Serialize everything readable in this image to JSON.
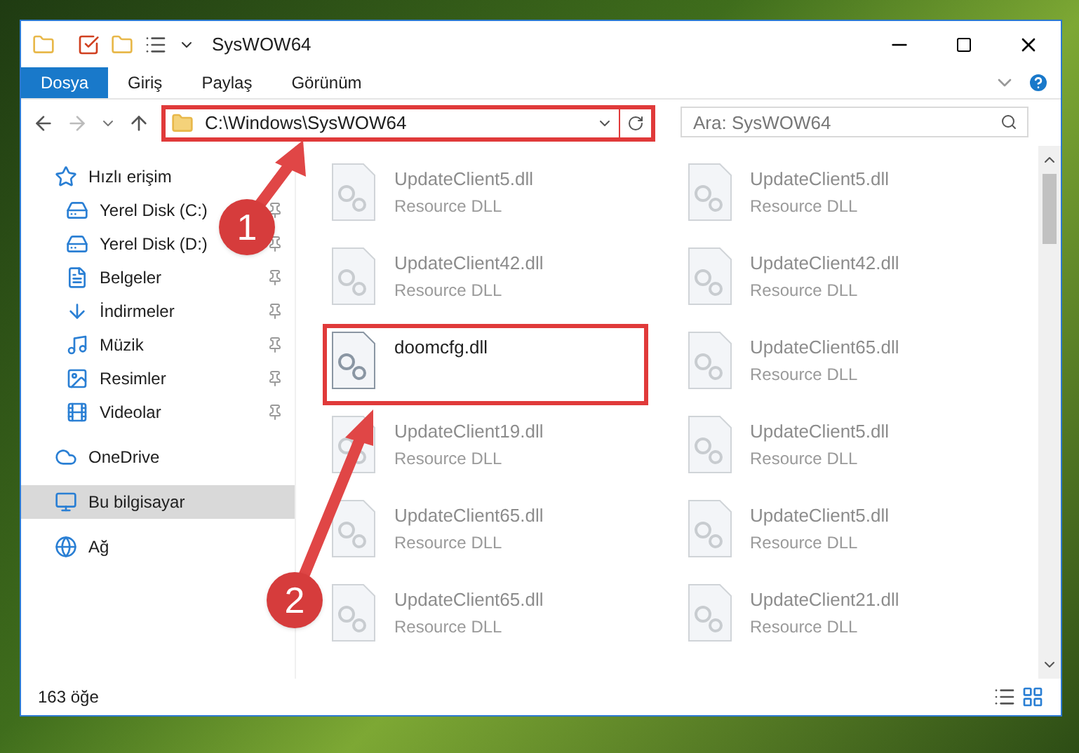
{
  "window": {
    "title": "SysWOW64"
  },
  "ribbon_tabs": [
    {
      "label": "Dosya",
      "selected": true
    },
    {
      "label": "Giriş",
      "selected": false
    },
    {
      "label": "Paylaş",
      "selected": false
    },
    {
      "label": "Görünüm",
      "selected": false
    }
  ],
  "address_bar": {
    "path": "C:\\Windows\\SysWOW64",
    "highlighted": true
  },
  "search": {
    "placeholder": "Ara: SysWOW64"
  },
  "sidebar": {
    "items": [
      {
        "label": "Hızlı erişim",
        "kind": "star",
        "selected": false,
        "children": [
          {
            "label": "Yerel Disk (C:)",
            "kind": "drive",
            "pinned": true,
            "selected": false
          },
          {
            "label": "Yerel Disk (D:)",
            "kind": "drive",
            "pinned": true,
            "selected": false
          },
          {
            "label": "Belgeler",
            "kind": "document",
            "pinned": true,
            "selected": false
          },
          {
            "label": "İndirmeler",
            "kind": "download",
            "pinned": true,
            "selected": false
          },
          {
            "label": "Müzik",
            "kind": "music",
            "pinned": true,
            "selected": false
          },
          {
            "label": "Resimler",
            "kind": "picture",
            "pinned": true,
            "selected": false
          },
          {
            "label": "Videolar",
            "kind": "video",
            "pinned": true,
            "selected": false
          }
        ]
      },
      {
        "label": "OneDrive",
        "kind": "cloud",
        "selected": false
      },
      {
        "label": "Bu bilgisayar",
        "kind": "computer",
        "selected": true
      },
      {
        "label": "Ağ",
        "kind": "network",
        "selected": false
      }
    ]
  },
  "files": [
    {
      "name": "UpdateClient5.dll",
      "type": "Resource DLL",
      "faded": true,
      "highlighted": false
    },
    {
      "name": "UpdateClient5.dll",
      "type": "Resource DLL",
      "faded": true,
      "highlighted": false
    },
    {
      "name": "UpdateClient42.dll",
      "type": "Resource DLL",
      "faded": true,
      "highlighted": false
    },
    {
      "name": "UpdateClient42.dll",
      "type": "Resource DLL",
      "faded": true,
      "highlighted": false
    },
    {
      "name": "doomcfg.dll",
      "faded": false,
      "highlighted": true
    },
    {
      "name": "UpdateClient65.dll",
      "type": "Resource DLL",
      "faded": true,
      "highlighted": false
    },
    {
      "name": "UpdateClient19.dll",
      "type": "Resource DLL",
      "faded": true,
      "highlighted": false
    },
    {
      "name": "UpdateClient5.dll",
      "type": "Resource DLL",
      "faded": true,
      "highlighted": false
    },
    {
      "name": "UpdateClient65.dll",
      "type": "Resource DLL",
      "faded": true,
      "highlighted": false
    },
    {
      "name": "UpdateClient5.dll",
      "type": "Resource DLL",
      "faded": true,
      "highlighted": false
    },
    {
      "name": "UpdateClient65.dll",
      "type": "Resource DLL",
      "faded": true,
      "highlighted": false
    },
    {
      "name": "UpdateClient21.dll",
      "type": "Resource DLL",
      "faded": true,
      "highlighted": false
    }
  ],
  "status_bar": {
    "item_count": "163 öğe"
  },
  "callouts": [
    {
      "number": "1"
    },
    {
      "number": "2"
    }
  ]
}
